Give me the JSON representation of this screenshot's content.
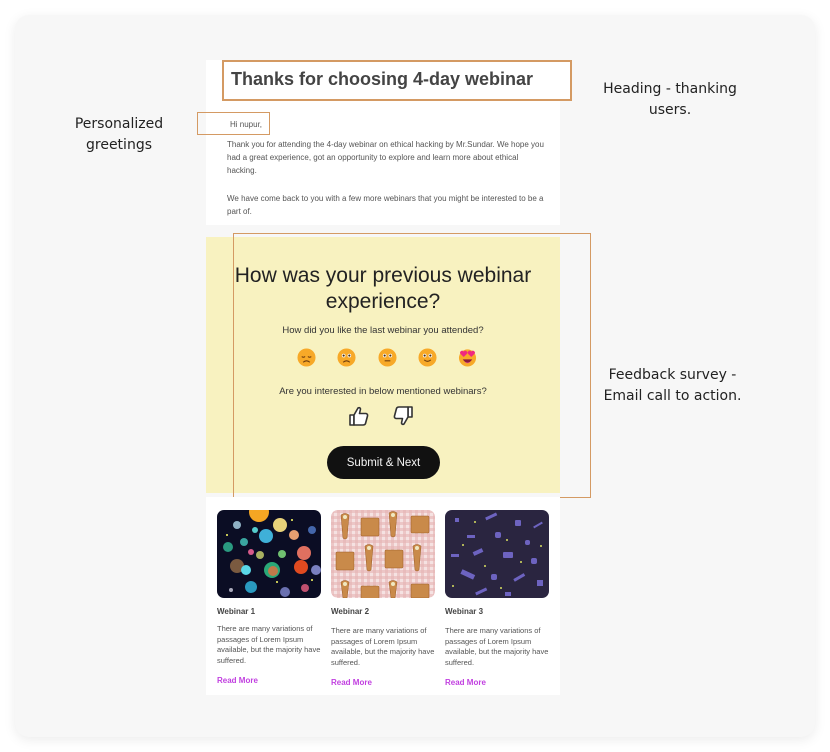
{
  "annotations": {
    "greetings": "Personalized greetings",
    "heading": "Heading - thanking users.",
    "feedback": "Feedback survey - Email call to action."
  },
  "email": {
    "heading": "Thanks for choosing 4-day webinar",
    "greeting": "Hi nupur,",
    "paragraph1": "Thank you for attending the 4-day webinar on ethical hacking by Mr.Sundar. We hope you had a great experience, got an opportunity to explore and learn more about ethical hacking.",
    "paragraph2": "We have come back to you with a few more webinars that you might be interested to be a part of."
  },
  "survey": {
    "title": "How was your previous webinar experience?",
    "question1": "How did you like the last webinar you attended?",
    "ratings": [
      {
        "icon": "disappointed-face-icon"
      },
      {
        "icon": "frowning-face-icon"
      },
      {
        "icon": "neutral-face-icon"
      },
      {
        "icon": "slightly-smiling-face-icon"
      },
      {
        "icon": "heart-eyes-face-icon"
      }
    ],
    "question2": "Are you interested in below mentioned webinars?",
    "thumbs_up_icon": "thumbs-up-icon",
    "thumbs_down_icon": "thumbs-down-icon",
    "submit_label": "Submit & Next"
  },
  "webinars": [
    {
      "title": "Webinar 1",
      "description": "There are many variations of passages of Lorem Ipsum available, but the majority have suffered.",
      "link": "Read More",
      "image": "planets-pattern"
    },
    {
      "title": "Webinar 2",
      "description": "There are many variations of passages of Lorem Ipsum available, but the majority have suffered.",
      "link": "Read More",
      "image": "waffles-pattern"
    },
    {
      "title": "Webinar 3",
      "description": "There are many variations of passages of Lorem Ipsum available, but the majority have suffered.",
      "link": "Read More",
      "image": "isometric-tech-pattern"
    }
  ],
  "colors": {
    "highlight": "#d49a63",
    "survey_bg": "#f8f2c0",
    "link": "#c13fe0",
    "button": "#111111"
  }
}
